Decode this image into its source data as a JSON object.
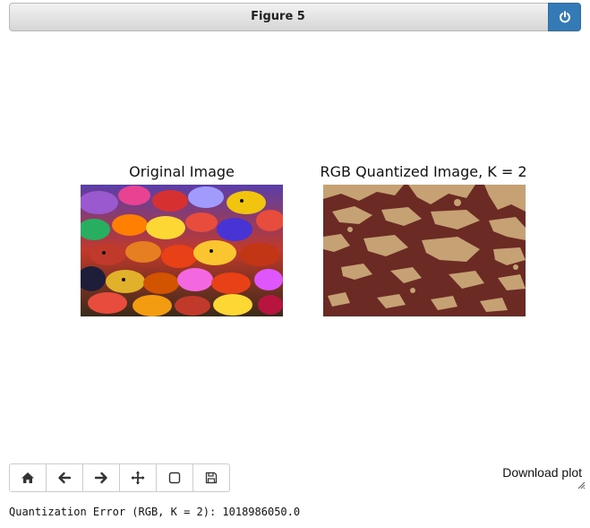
{
  "figure": {
    "title": "Figure 5",
    "power_icon": "power-icon"
  },
  "plots": [
    {
      "title": "Original Image"
    },
    {
      "title": "RGB Quantized Image, K = 2"
    }
  ],
  "quantized_colors": [
    "#6b2a23",
    "#c5a174"
  ],
  "toolbar": {
    "buttons": [
      {
        "name": "home",
        "icon": "home-icon"
      },
      {
        "name": "back",
        "icon": "arrow-left-icon"
      },
      {
        "name": "forward",
        "icon": "arrow-right-icon"
      },
      {
        "name": "pan",
        "icon": "move-icon"
      },
      {
        "name": "zoom",
        "icon": "square-icon"
      },
      {
        "name": "save",
        "icon": "floppy-icon"
      }
    ],
    "download_label": "Download plot"
  },
  "output": {
    "text": "Quantization Error (RGB, K = 2): 1018986050.0"
  },
  "accent_color": "#337ab7"
}
